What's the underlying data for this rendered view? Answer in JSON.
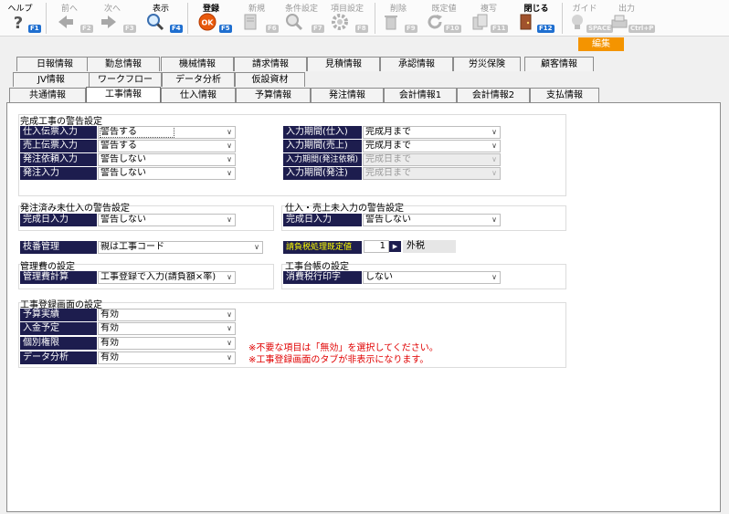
{
  "toolbar": {
    "help": {
      "label": "ヘルプ",
      "key": "F1"
    },
    "prev": {
      "label": "前へ",
      "key": "F2"
    },
    "next": {
      "label": "次へ",
      "key": "F3"
    },
    "show": {
      "label": "表示",
      "key": "F4"
    },
    "register": {
      "label": "登録",
      "key": "F5"
    },
    "new": {
      "label": "新規",
      "key": "F6"
    },
    "condition": {
      "label": "条件設定",
      "key": "F7"
    },
    "item": {
      "label": "項目設定",
      "key": "F8"
    },
    "delete": {
      "label": "削除",
      "key": "F9"
    },
    "default": {
      "label": "既定値",
      "key": "F10"
    },
    "copy": {
      "label": "複写",
      "key": "F11"
    },
    "close": {
      "label": "閉じる",
      "key": "F12"
    },
    "guide": {
      "label": "ガイド",
      "key": "SPACE"
    },
    "output": {
      "label": "出力",
      "key": "Ctrl+P"
    }
  },
  "mode_badge": "編集",
  "tabs": {
    "row1": [
      "日報情報",
      "勤怠情報",
      "機械情報",
      "請求情報",
      "見積情報",
      "承認情報",
      "労災保険",
      "顧客情報"
    ],
    "row2": [
      "JV情報",
      "ワークフロー",
      "データ分析",
      "仮設資材"
    ],
    "row3": [
      "共通情報",
      "工事情報",
      "仕入情報",
      "予算情報",
      "発注情報",
      "会計情報1",
      "会計情報2",
      "支払情報"
    ],
    "active": "工事情報"
  },
  "warning": {
    "title": "完成工事の警告設定",
    "left": [
      {
        "label": "仕入伝票入力",
        "value": "警告する"
      },
      {
        "label": "売上伝票入力",
        "value": "警告する"
      },
      {
        "label": "発注依頼入力",
        "value": "警告しない"
      },
      {
        "label": "発注入力",
        "value": "警告しない"
      }
    ],
    "right": [
      {
        "label": "入力期間(仕入)",
        "value": "完成月まで"
      },
      {
        "label": "入力期間(売上)",
        "value": "完成月まで"
      },
      {
        "label": "入力期間(発注依頼)",
        "value": "完成日まで"
      },
      {
        "label": "入力期間(発注)",
        "value": "完成日まで"
      }
    ]
  },
  "unpurchased": {
    "title": "発注済み未仕入の警告設定",
    "label": "完成日入力",
    "value": "警告しない"
  },
  "unsold": {
    "title": "仕入・売上未入力の警告設定",
    "label": "完成日入力",
    "value": "警告しない"
  },
  "branch": {
    "label": "枝番管理",
    "value": "親は工事コード"
  },
  "billing_tax": {
    "label": "請負税処理既定値",
    "value": "1",
    "text": "外税"
  },
  "mgmt": {
    "title": "管理費の設定",
    "label": "管理費計算",
    "value": "工事登録で入力(請負額×率)"
  },
  "ledger": {
    "title": "工事台帳の設定",
    "label": "消費税行印字",
    "value": "しない"
  },
  "screen": {
    "title": "工事登録画面の設定",
    "items": [
      {
        "label": "予算実績",
        "value": "有効"
      },
      {
        "label": "入金予定",
        "value": "有効"
      },
      {
        "label": "個別権限",
        "value": "有効"
      },
      {
        "label": "データ分析",
        "value": "有効"
      }
    ],
    "note1": "※不要な項目は「無効」を選択してください。",
    "note2": "※工事登録画面のタブが非表示になります。"
  }
}
